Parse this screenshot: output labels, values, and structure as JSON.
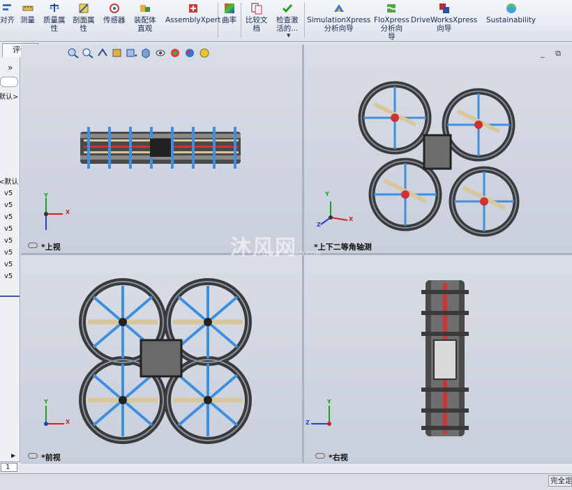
{
  "ribbon": {
    "items": [
      {
        "label": "对齐",
        "icon": "align-icon"
      },
      {
        "label": "测量",
        "icon": "measure-icon"
      },
      {
        "label": "质量属\n性",
        "icon": "mass-properties-icon"
      },
      {
        "label": "剖面属\n性",
        "icon": "section-properties-icon"
      },
      {
        "label": "传感器",
        "icon": "sensor-icon"
      },
      {
        "label": "装配体\n直观",
        "icon": "assembly-visualization-icon"
      },
      {
        "label": "AssemblyXpert",
        "icon": "assemblyxpert-icon"
      },
      {
        "label": "曲率",
        "icon": "curvature-icon"
      },
      {
        "label": "比较文\n档",
        "icon": "compare-documents-icon"
      },
      {
        "label": "检查激\n活的...",
        "icon": "check-active-icon"
      },
      {
        "label": "SimulationXpress\n分析向导",
        "icon": "simulationxpress-icon"
      },
      {
        "label": "FloXpress\n分析向\n导",
        "icon": "floxpress-icon"
      },
      {
        "label": "DriveWorksXpress\n向导",
        "icon": "driveworksxpress-icon"
      },
      {
        "label": "Sustainability",
        "icon": "sustainability-icon"
      }
    ]
  },
  "tabs": {
    "evaluate": "评估"
  },
  "left_panel": {
    "chevron": "»",
    "default_text": "默认>",
    "default_text2": "<默认",
    "rows": [
      "v5",
      "v5",
      "v5",
      "v5",
      "v5",
      "v5",
      "v5",
      "v5"
    ],
    "page_number": "1"
  },
  "viewports": {
    "top": {
      "label": "*上视"
    },
    "iso": {
      "label": "*上下二等角轴测"
    },
    "front": {
      "label": "*前视"
    },
    "right": {
      "label": "*右视"
    }
  },
  "triad": {
    "x": "X",
    "y": "Y",
    "z": "Z"
  },
  "status": {
    "text": "完全定义"
  },
  "watermark": {
    "text": "沐风网",
    "sub": "WWW.MFCAD.COM"
  },
  "colors": {
    "frame": "#3a3a3a",
    "spoke": "#3f8fe0",
    "prop": "#d8c79a",
    "accent": "#c0392b",
    "axis_x": "#d42020",
    "axis_y": "#1aa01a",
    "axis_z": "#2040c8"
  }
}
